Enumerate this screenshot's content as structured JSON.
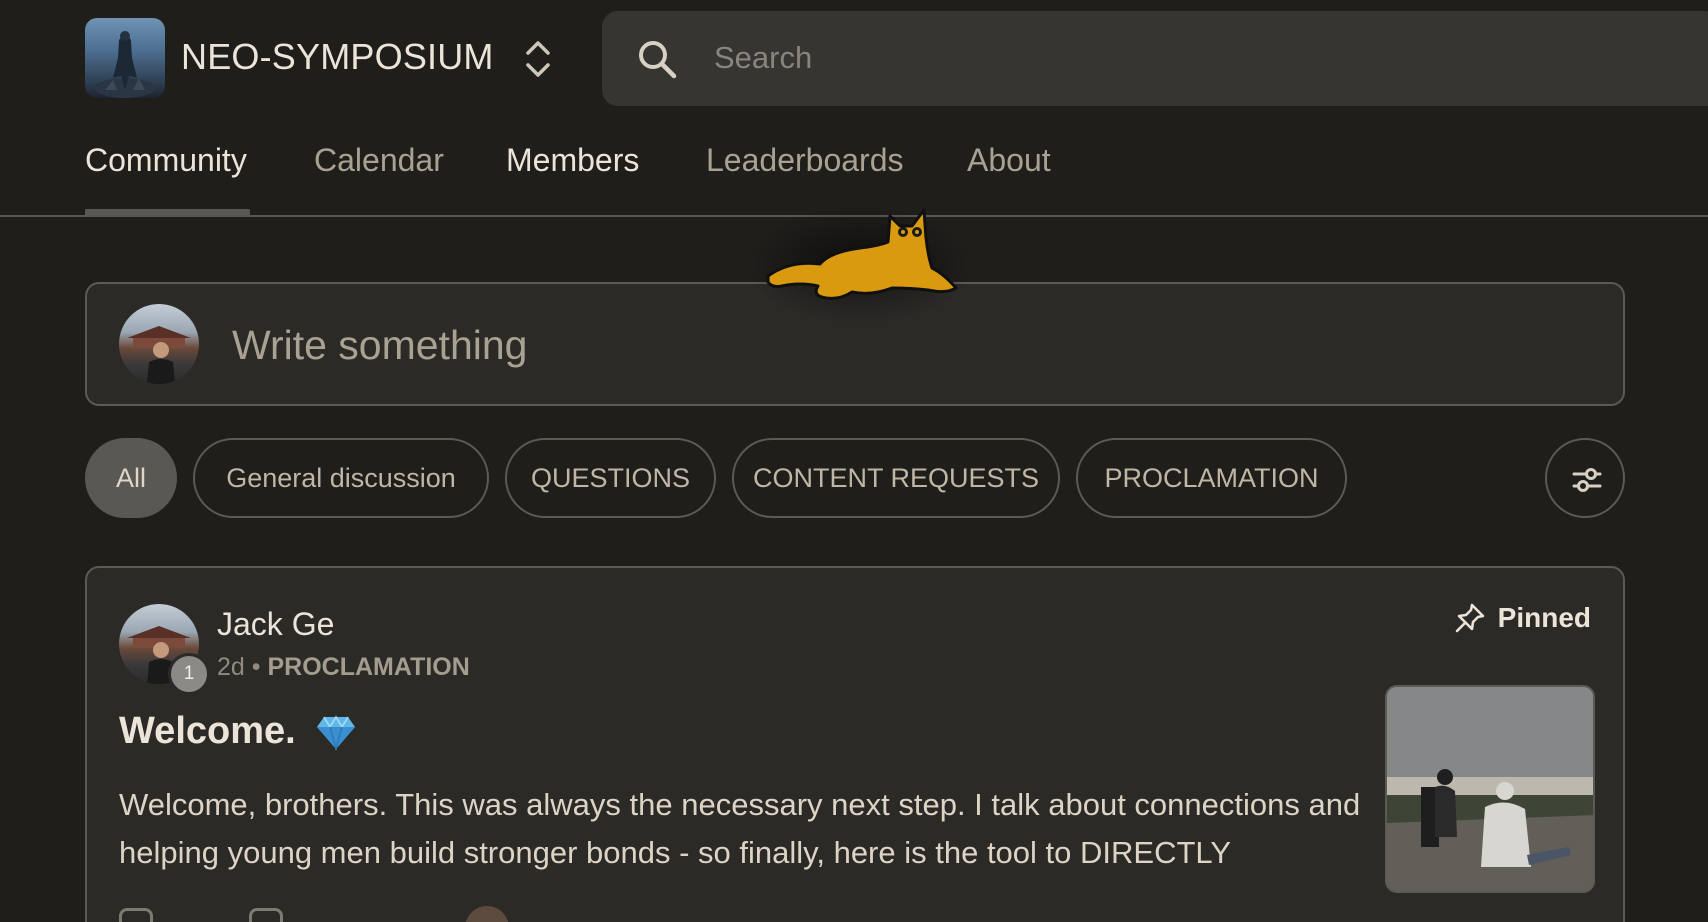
{
  "header": {
    "group_name": "NEO-SYMPOSIUM",
    "search_placeholder": "Search"
  },
  "nav": {
    "tabs": [
      {
        "label": "Community",
        "active": true
      },
      {
        "label": "Calendar",
        "active": false
      },
      {
        "label": "Members",
        "active": false
      },
      {
        "label": "Leaderboards",
        "active": false
      },
      {
        "label": "About",
        "active": false
      }
    ]
  },
  "composer": {
    "placeholder": "Write something"
  },
  "filters": {
    "chips": [
      {
        "label": "All",
        "active": true
      },
      {
        "label": "General discussion",
        "active": false
      },
      {
        "label": "QUESTIONS",
        "active": false
      },
      {
        "label": "CONTENT REQUESTS",
        "active": false
      },
      {
        "label": "PROCLAMATION",
        "active": false
      }
    ]
  },
  "post": {
    "author": "Jack Ge",
    "level": "1",
    "age": "2d",
    "separator": "•",
    "category": "PROCLAMATION",
    "pinned_label": "Pinned",
    "title": "Welcome.",
    "body": "Welcome, brothers. This was always the necessary next step. I talk about connections and helping young men build stronger bonds - so finally, here is the tool to DIRECTLY"
  },
  "icons": {
    "logo": "hooded-figure-logo",
    "switcher": "chevron-up-down-icon",
    "search": "search-icon",
    "filter": "sliders-icon",
    "pin": "pin-icon",
    "gem": "gem-emoji",
    "mascot": "cat-mascot"
  },
  "colors": {
    "background": "#1f1e1b",
    "surface": "#2b2a27",
    "border": "#5d5a53",
    "text_primary": "#ece4d8",
    "text_muted": "#a9a293",
    "mascot": "#d99a10"
  }
}
